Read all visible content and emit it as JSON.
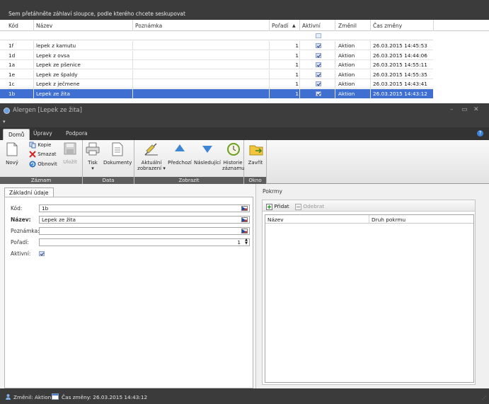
{
  "grid": {
    "group_hint": "Sem přetáhněte záhlaví sloupce, podle kterého chcete seskupovat",
    "columns": {
      "code": "Kód",
      "name": "Název",
      "note": "Poznámka",
      "order": "Pořadí",
      "sort_indicator": "▲",
      "active": "Aktivní",
      "changed_by": "Změnil",
      "changed_at": "Čas změny"
    },
    "rows": [
      {
        "code": "1f",
        "name": "lepek z kamutu",
        "order": "1",
        "changed_by": "Aktion",
        "changed_at": "26.03.2015 14:45:53"
      },
      {
        "code": "1d",
        "name": "Lepek z ovsa",
        "order": "1",
        "changed_by": "Aktion",
        "changed_at": "26.03.2015 14:44:06"
      },
      {
        "code": "1a",
        "name": "Lepek ze pšenice",
        "order": "1",
        "changed_by": "Aktion",
        "changed_at": "26.03.2015 14:55:11"
      },
      {
        "code": "1e",
        "name": "Lepek ze špaldy",
        "order": "1",
        "changed_by": "Aktion",
        "changed_at": "26.03.2015 14:55:35"
      },
      {
        "code": "1c",
        "name": "Lepek z ječmene",
        "order": "1",
        "changed_by": "Aktion",
        "changed_at": "26.03.2015 14:43:41"
      },
      {
        "code": "1b",
        "name": "Lepek ze žita",
        "order": "1",
        "changed_by": "Aktion",
        "changed_at": "26.03.2015 14:43:12"
      }
    ],
    "selected_index": 5
  },
  "window": {
    "title": "Alergen [Lepek ze žita]",
    "controls": {
      "minimize": "–",
      "maximize": "▭",
      "close": "✕"
    }
  },
  "ribbon": {
    "tabs": [
      "Domů",
      "Úpravy",
      "Podpora"
    ],
    "active_tab": 0,
    "groups": {
      "record": "Záznam",
      "data": "Data",
      "view": "Zobrazit",
      "window": "Okno"
    },
    "buttons": {
      "new": "Nový",
      "copy": "Kopie",
      "delete": "Smazat",
      "refresh": "Obnovit",
      "save": "Uložit",
      "print": "Tisk",
      "documents": "Dokumenty",
      "current_view_1": "Aktuální",
      "current_view_2": "zobrazení",
      "previous": "Předchozí",
      "next": "Následující",
      "history_1": "Historie",
      "history_2": "záznamu",
      "close": "Zavřít"
    }
  },
  "form": {
    "tab": "Základní údaje",
    "fields": {
      "code_label": "Kód:",
      "code_value": "1b",
      "name_label": "Název:",
      "name_value": "Lepek ze žita",
      "note_label": "Poznámka:",
      "note_value": "",
      "order_label": "Pořadí:",
      "order_value": "1",
      "active_label": "Aktivní:"
    }
  },
  "dishes": {
    "title": "Pokrmy",
    "add": "Přidat",
    "remove": "Odebrat",
    "columns": {
      "name": "Název",
      "kind": "Druh pokrmu"
    }
  },
  "status": {
    "changed_by": "Změnil: Aktion",
    "changed_at": "Čas změny: 26.03.2015 14:43:12"
  },
  "colors": {
    "selection": "#3f6fd0",
    "dark_chrome": "#3b3b3b",
    "accent_blue": "#3d83d8"
  }
}
